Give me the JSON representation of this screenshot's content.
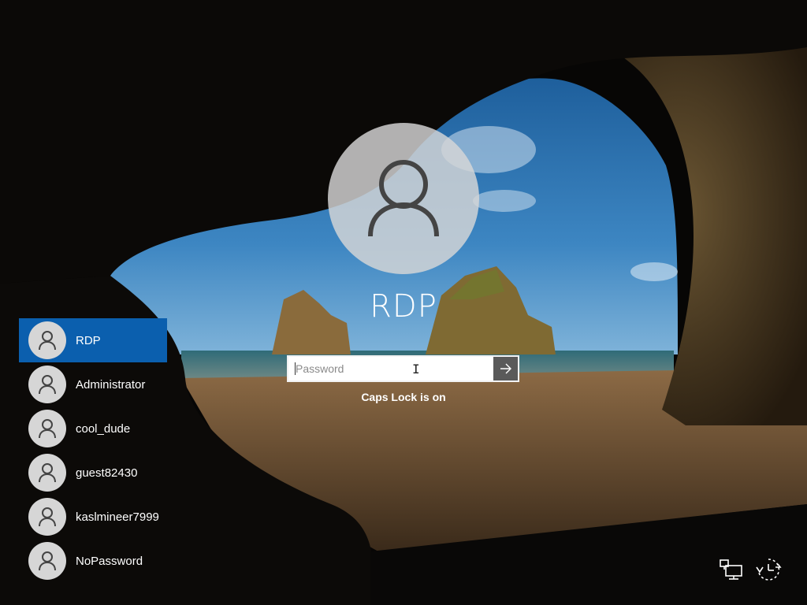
{
  "current_user": {
    "name": "RDP",
    "password_placeholder": "Password",
    "submit_icon": "arrow-right-icon",
    "caps_lock_message": "Caps Lock is on"
  },
  "users": [
    {
      "name": "RDP",
      "selected": true
    },
    {
      "name": "Administrator",
      "selected": false
    },
    {
      "name": "cool_dude",
      "selected": false
    },
    {
      "name": "guest82430",
      "selected": false
    },
    {
      "name": "kaslmineer7999",
      "selected": false
    },
    {
      "name": "NoPassword",
      "selected": false
    }
  ],
  "system_icons": [
    "network-icon",
    "ease-of-access-icon"
  ],
  "colors": {
    "selected_user_bg": "#0b5fae",
    "avatar_bg": "#d6d6d6",
    "submit_bg": "#5a5a5a"
  }
}
